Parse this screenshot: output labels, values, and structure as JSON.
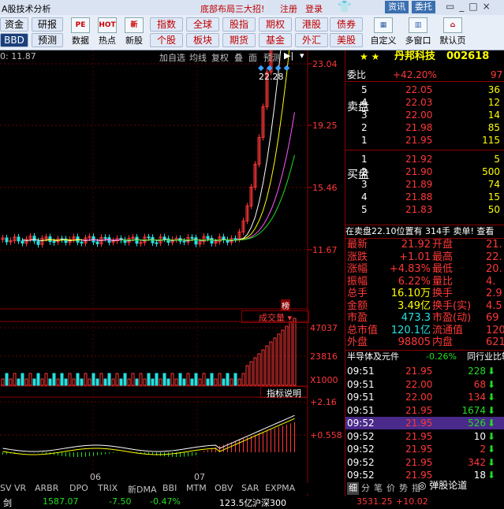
{
  "titlebar": {
    "app": "A股技术分析",
    "promo": "底部布局三大招!",
    "register": "注册",
    "login": "登录",
    "btn_zixun": "资讯",
    "btn_tuoguan": "委托"
  },
  "toolbar": {
    "row1": [
      "资金",
      "研报",
      "指数",
      "全球",
      "股指",
      "期权",
      "港股",
      "债券"
    ],
    "row2": [
      "预测",
      "个股",
      "板块",
      "期货",
      "基金",
      "外汇",
      "美股"
    ],
    "left_tag": "BBD",
    "icons": [
      {
        "label": "数据",
        "glyph": "PE"
      },
      {
        "label": "热点",
        "glyph": "HOT"
      },
      {
        "label": "新股",
        "glyph": "新"
      }
    ],
    "right_icons": [
      {
        "label": "自定义",
        "icon": "grid-icon"
      },
      {
        "label": "多窗口",
        "icon": "windows-icon"
      },
      {
        "label": "默认页",
        "icon": "home-icon"
      }
    ]
  },
  "chart": {
    "ma_hint": "0: 11.87",
    "menu": [
      "加自选",
      "均线",
      "复权",
      "叠",
      "面",
      "预测"
    ],
    "price_axis": [
      "23.04",
      "19.25",
      "15.46",
      "11.67"
    ],
    "high_label": "22.28",
    "bang": "榜",
    "volume_title": "成交量",
    "volume_axis": [
      "47037",
      "23816",
      "X1000"
    ],
    "indicator_title": "指标说明",
    "macd_axis": [
      "+2.16",
      "+0.558"
    ],
    "months": [
      "06",
      "07"
    ],
    "tabs": [
      "SV",
      "VR",
      "ARBR",
      "DPO",
      "TRIX",
      "新DMA",
      "BBI",
      "MTM",
      "OBV",
      "SAR",
      "EXPMA"
    ]
  },
  "panel": {
    "stock_name": "丹邦科技",
    "stock_code": "002618",
    "weibi_label": "委比",
    "weibi_value": "+42.20%",
    "weibi_extra": "97",
    "sell_label": "卖盘",
    "buy_label": "买盘",
    "sell": [
      {
        "lvl": "5",
        "price": "22.05",
        "vol": "36"
      },
      {
        "lvl": "4",
        "price": "22.03",
        "vol": "12"
      },
      {
        "lvl": "3",
        "price": "22.00",
        "vol": "14"
      },
      {
        "lvl": "2",
        "price": "21.98",
        "vol": "85"
      },
      {
        "lvl": "1",
        "price": "21.95",
        "vol": "115"
      }
    ],
    "buy": [
      {
        "lvl": "1",
        "price": "21.92",
        "vol": "5"
      },
      {
        "lvl": "2",
        "price": "21.90",
        "vol": "500"
      },
      {
        "lvl": "3",
        "price": "21.89",
        "vol": "74"
      },
      {
        "lvl": "4",
        "price": "21.88",
        "vol": "15"
      },
      {
        "lvl": "5",
        "price": "21.83",
        "vol": "50"
      }
    ],
    "notice": "在卖盘22.10位置有 314手 卖单! 查看",
    "stats": [
      {
        "k1": "最新",
        "v1": "21.92",
        "k2": "开盘",
        "v2": "21."
      },
      {
        "k1": "涨跌",
        "v1": "+1.01",
        "k2": "最高",
        "v2": "22."
      },
      {
        "k1": "涨幅",
        "v1": "+4.83%",
        "k2": "最低",
        "v2": "20."
      },
      {
        "k1": "振幅",
        "v1": "6.22%",
        "k2": "量比",
        "v2": "4."
      },
      {
        "k1": "总手",
        "v1": "16.10万",
        "k2": "换手",
        "v2": "2.9"
      },
      {
        "k1": "金额",
        "v1": "3.49亿",
        "k2": "换手(实)",
        "v2": "4.5"
      },
      {
        "k1": "市盈",
        "v1": "473.3",
        "k2": "市盈(动)",
        "v2": "69"
      },
      {
        "k1": "总市值",
        "v1": "120.1亿",
        "k2": "流通值",
        "v2": "120.1"
      },
      {
        "k1": "外盘",
        "v1": "98805",
        "k2": "内盘",
        "v2": "621"
      }
    ],
    "sector": "半导体及元件",
    "sector_change": "-0.26%",
    "sector_tab": "同行业比较",
    "ticks": [
      {
        "time": "09:51",
        "price": "21.95",
        "vol": "228",
        "dir": "down"
      },
      {
        "time": "09:51",
        "price": "22.00",
        "vol": "68",
        "dir": "down"
      },
      {
        "time": "09:51",
        "price": "22.00",
        "vol": "134",
        "dir": "down"
      },
      {
        "time": "09:51",
        "price": "21.95",
        "vol": "1674",
        "dir": "down"
      },
      {
        "time": "09:52",
        "price": "21.95",
        "vol": "526",
        "dir": "down"
      },
      {
        "time": "09:52",
        "price": "21.95",
        "vol": "10",
        "dir": "down"
      },
      {
        "time": "09:52",
        "price": "21.95",
        "vol": "2",
        "dir": "down"
      },
      {
        "time": "09:52",
        "price": "21.95",
        "vol": "342",
        "dir": "down"
      },
      {
        "time": "09:52",
        "price": "21.95",
        "vol": "18",
        "dir": "down"
      }
    ],
    "watermark": "弹股论道",
    "bottom_tabs": [
      "细",
      "分",
      "笔",
      "价",
      "势",
      "指"
    ]
  },
  "statusbar": {
    "left": "剑",
    "v1": "1587.07",
    "v2": "-7.50",
    "v3": "-0.47%",
    "v4": "123.5亿",
    "v5": "沪深300",
    "v6": "3531.25",
    "v7": "+10.02"
  }
}
